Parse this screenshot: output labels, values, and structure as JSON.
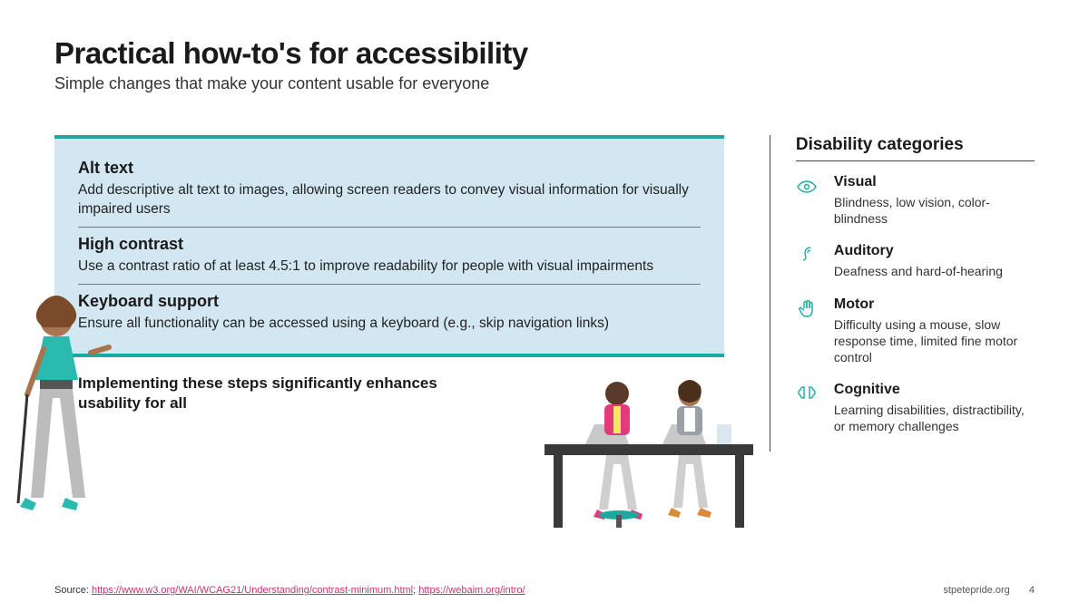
{
  "title": "Practical how-to's for accessibility",
  "subtitle": "Simple changes that make your content usable for everyone",
  "tips": [
    {
      "title": "Alt text",
      "desc": "Add descriptive alt text to images, allowing screen readers to convey visual information for visually impaired users"
    },
    {
      "title": "High contrast",
      "desc": "Use a contrast ratio of at least 4.5:1 to improve readability for people with visual impairments"
    },
    {
      "title": "Keyboard support",
      "desc": "Ensure all functionality can be accessed using a keyboard (e.g., skip navigation links)"
    }
  ],
  "summary": "Implementing these steps significantly enhances usability for all",
  "right_title": "Disability categories",
  "categories": [
    {
      "icon": "eye-icon",
      "name": "Visual",
      "desc": "Blindness, low vision, color-blindness"
    },
    {
      "icon": "ear-icon",
      "name": "Auditory",
      "desc": "Deafness and hard-of-hearing"
    },
    {
      "icon": "hand-icon",
      "name": "Motor",
      "desc": "Difficulty using a mouse, slow response time, limited fine motor control"
    },
    {
      "icon": "brain-icon",
      "name": "Cognitive",
      "desc": "Learning disabilities, distractibility, or memory challenges"
    }
  ],
  "source_label": "Source: ",
  "source_link1_text": "https://www.w3.org/WAI/WCAG21/Understanding/contrast-minimum.html",
  "source_sep": "; ",
  "source_link2_text": "https://webaim.org/intro/",
  "footer_site": "stpetepride.org",
  "page_number": "4"
}
